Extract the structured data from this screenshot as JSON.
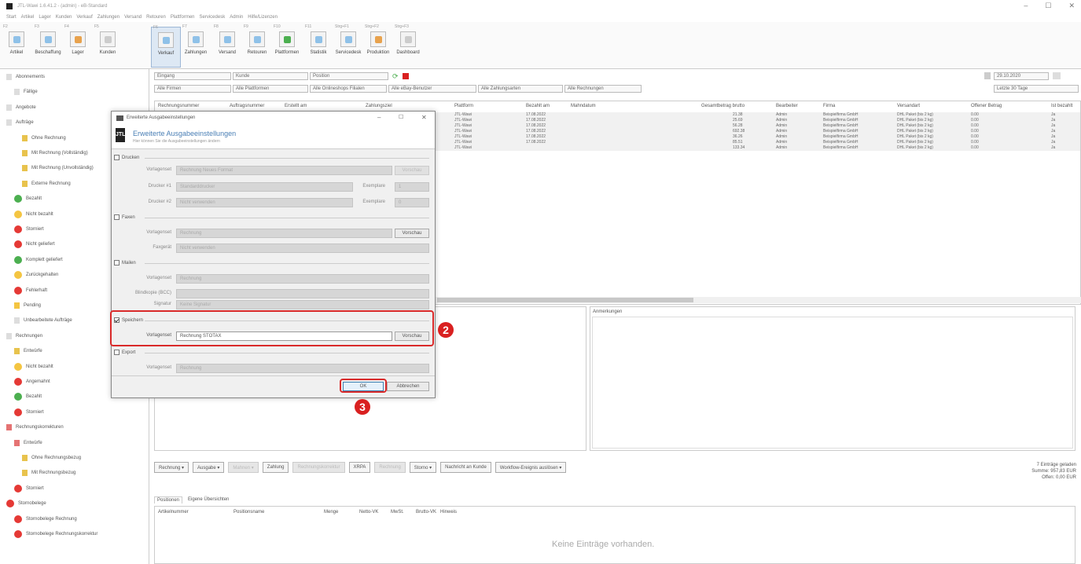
{
  "window": {
    "title": "JTL-Wawi 1.6.41.2 - (admin) - eB-Standard",
    "minimize": "–",
    "maximize": "☐",
    "close": "✕"
  },
  "menu": [
    "Start",
    "Artikel",
    "Lager",
    "Kunden",
    "Verkauf",
    "Zahlungen",
    "Versand",
    "Retouren",
    "Plattformen",
    "Servicedesk",
    "Admin",
    "Hilfe/Lizenzen"
  ],
  "ribbon": [
    {
      "key": "F2",
      "label": "Artikel",
      "color": "#8fc1e8"
    },
    {
      "key": "F3",
      "label": "Beschaffung",
      "color": "#8fc1e8"
    },
    {
      "key": "F4",
      "label": "Lager",
      "color": "#e8a24d"
    },
    {
      "key": "F5",
      "label": "Kunden",
      "color": "#cccccc"
    },
    {
      "key": "F6",
      "label": "Verkauf",
      "color": "#8fc1e8"
    },
    {
      "key": "F7",
      "label": "Zahlungen",
      "color": "#8fc1e8"
    },
    {
      "key": "F8",
      "label": "Versand",
      "color": "#8fc1e8"
    },
    {
      "key": "F9",
      "label": "Retouren",
      "color": "#8fc1e8"
    },
    {
      "key": "F10",
      "label": "Plattformen",
      "color": "#4caf50"
    },
    {
      "key": "F11",
      "label": "Statistik",
      "color": "#8fc1e8"
    },
    {
      "key": "Strg+F1",
      "label": "Servicedesk",
      "color": "#8fc1e8"
    },
    {
      "key": "Strg+F2",
      "label": "Produktion",
      "color": "#e8a24d"
    },
    {
      "key": "Strg+F3",
      "label": "Dashboard",
      "color": "#cccccc"
    }
  ],
  "sidebar": [
    {
      "label": "Abonnements",
      "type": "sq",
      "color": "#dddddd",
      "indent": 0
    },
    {
      "label": "Fällige",
      "type": "sq",
      "color": "#dddddd",
      "indent": 10
    },
    {
      "label": "Angebote",
      "type": "sq",
      "color": "#dddddd",
      "indent": 0
    },
    {
      "label": "Aufträge",
      "type": "sq",
      "color": "#dddddd",
      "indent": 0
    },
    {
      "label": "Ohne Rechnung",
      "type": "sq",
      "color": "#e8c34d",
      "indent": 20
    },
    {
      "label": "Mit Rechnung (Vollständig)",
      "type": "sq",
      "color": "#e8c34d",
      "indent": 20
    },
    {
      "label": "Mit Rechnung (Unvollständig)",
      "type": "sq",
      "color": "#e8c34d",
      "indent": 20
    },
    {
      "label": "Externe Rechnung",
      "type": "sq",
      "color": "#e8c34d",
      "indent": 20
    },
    {
      "label": "Bezahlt",
      "type": "dot",
      "color": "#4caf50",
      "indent": 10
    },
    {
      "label": "Nicht bezahlt",
      "type": "dot",
      "color": "#f4c542",
      "indent": 10
    },
    {
      "label": "Storniert",
      "type": "dot",
      "color": "#e53935",
      "indent": 10
    },
    {
      "label": "Nicht geliefert",
      "type": "dot",
      "color": "#e53935",
      "indent": 10
    },
    {
      "label": "Komplett geliefert",
      "type": "dot",
      "color": "#4caf50",
      "indent": 10
    },
    {
      "label": "Zurückgehalten",
      "type": "dot",
      "color": "#f4c542",
      "indent": 10
    },
    {
      "label": "Fehlerhaft",
      "type": "dot",
      "color": "#e53935",
      "indent": 10
    },
    {
      "label": "Pending",
      "type": "sq",
      "color": "#f4c542",
      "indent": 10
    },
    {
      "label": "Unbearbeitete Aufträge",
      "type": "sq",
      "color": "#dddddd",
      "indent": 10
    },
    {
      "label": "Rechnungen",
      "type": "sq",
      "color": "#dddddd",
      "indent": 0
    },
    {
      "label": "Entwürfe",
      "type": "sq",
      "color": "#e8c34d",
      "indent": 10
    },
    {
      "label": "Nicht bezahlt",
      "type": "dot",
      "color": "#f4c542",
      "indent": 10
    },
    {
      "label": "Angemahnt",
      "type": "dot",
      "color": "#e53935",
      "indent": 10
    },
    {
      "label": "Bezahlt",
      "type": "dot",
      "color": "#4caf50",
      "indent": 10
    },
    {
      "label": "Storniert",
      "type": "dot",
      "color": "#e53935",
      "indent": 10
    },
    {
      "label": "Rechnungskorrekturen",
      "type": "sq",
      "color": "#e57373",
      "indent": 0
    },
    {
      "label": "Entwürfe",
      "type": "sq",
      "color": "#e57373",
      "indent": 10
    },
    {
      "label": "Ohne Rechnungsbezug",
      "type": "sq",
      "color": "#e8c34d",
      "indent": 20
    },
    {
      "label": "Mit Rechnungsbezug",
      "type": "sq",
      "color": "#e8c34d",
      "indent": 20
    },
    {
      "label": "Storniert",
      "type": "dot",
      "color": "#e53935",
      "indent": 10
    },
    {
      "label": "Stornobelege",
      "type": "dot",
      "color": "#e53935",
      "indent": 0
    },
    {
      "label": "Stornobelege Rechnung",
      "type": "dot",
      "color": "#e53935",
      "indent": 10
    },
    {
      "label": "Stornobelege Rechnungskorrektur",
      "type": "dot",
      "color": "#e53935",
      "indent": 10
    }
  ],
  "filters": {
    "row1": [
      "Eingang",
      "Kunde",
      "Position"
    ],
    "row2": [
      "Alle Firmen",
      "Alle Plattformen",
      "Alle Onlineshops Filialen",
      "Alle eBay-Benutzer",
      "Alle Zahlungsarten",
      "Alle Rechnungen"
    ],
    "date": "29.10.2020",
    "range": "Letzte 30 Tage"
  },
  "grid": {
    "headers": [
      "Rechnungsnummer",
      "Auftragsnummer",
      "Erstellt am",
      "Zahlungsziel",
      "Plattform",
      "Bezahlt am",
      "Mahndatum",
      "Gesamtbetrag brutto",
      "Bearbeiter",
      "Firma",
      "Versandart",
      "Offener Betrag",
      "Ist bezahlt"
    ],
    "rows": [
      [
        "JTL-Wawi",
        "17.08.2022",
        "21.38",
        "Admin",
        "Beispielfirma GmbH",
        "DHL Paket (bis 2 kg)",
        "0.00",
        "Ja"
      ],
      [
        "JTL-Wawi",
        "17.08.2022",
        "25.69",
        "Admin",
        "Beispielfirma GmbH",
        "DHL Paket (bis 2 kg)",
        "0.00",
        "Ja"
      ],
      [
        "JTL-Wawi",
        "17.08.2022",
        "56.28",
        "Admin",
        "Beispielfirma GmbH",
        "DHL Paket (bis 2 kg)",
        "0.00",
        "Ja"
      ],
      [
        "JTL-Wawi",
        "17.08.2022",
        "692.38",
        "Admin",
        "Beispielfirma GmbH",
        "DHL Paket (bis 2 kg)",
        "0.00",
        "Ja"
      ],
      [
        "JTL-Wawi",
        "17.08.2022",
        "36.26",
        "Admin",
        "Beispielfirma GmbH",
        "DHL Paket (bis 2 kg)",
        "0.00",
        "Ja"
      ],
      [
        "JTL-Wawi",
        "17.08.2022",
        "85.51",
        "Admin",
        "Beispielfirma GmbH",
        "DHL Paket (bis 2 kg)",
        "0.00",
        "Ja"
      ],
      [
        "JTL-Wawi",
        "",
        "133.34",
        "Admin",
        "Beispielfirma GmbH",
        "DHL Paket (bis 2 kg)",
        "0.00",
        "Ja"
      ]
    ]
  },
  "notes_label": "Anmerkungen",
  "actions": [
    {
      "label": "Rechnung ▾",
      "dis": false
    },
    {
      "label": "Ausgabe ▾",
      "dis": false
    },
    {
      "label": "Mahnen ▾",
      "dis": true
    },
    {
      "label": "Zahlung",
      "dis": false
    },
    {
      "label": "Rechnungskorrektur",
      "dis": true
    },
    {
      "label": "XRPA",
      "dis": false
    },
    {
      "label": "Rechnung",
      "dis": true
    },
    {
      "label": "Storno ▾",
      "dis": false
    },
    {
      "label": "Nachricht an Kunde",
      "dis": false
    },
    {
      "label": "Workflow-Ereignis auslösen ▾",
      "dis": false
    }
  ],
  "summary": {
    "count": "7 Einträge geladen",
    "sum": "Summe: 957,83 EUR",
    "open": "Offen: 0,00 EUR"
  },
  "bottom_tabs": [
    "Positionen",
    "Eigene Übersichten"
  ],
  "bottom_headers": [
    "Artikelnummer",
    "Positionsname",
    "Menge",
    "Netto-VK",
    "MwSt.",
    "Brutto-VK",
    "Hinweis"
  ],
  "empty_text": "Keine Einträge vorhanden.",
  "dialog": {
    "title": "Erweiterte Ausgabeeinstellungen",
    "header_title": "Erweiterte Ausgabeeinstellungen",
    "header_sub": "Hier können Sie die Ausgabeeinstellungen ändern",
    "logo": "JTL",
    "sections": {
      "print": {
        "label": "Drucken",
        "vorlage_label": "Vorlagenset",
        "vorlage": "Rechnung Neues Format",
        "vorschau": "Vorschau",
        "drucker1_label": "Drucker #1",
        "drucker1": "Standarddrucker",
        "drucker2_label": "Drucker #2",
        "drucker2": "Nicht verwenden",
        "exemplare_label": "Exemplare",
        "exemplare1": "1",
        "exemplare2": "0"
      },
      "fax": {
        "label": "Faxen",
        "vorlage_label": "Vorlagenset",
        "vorlage": "Rechnung",
        "vorschau": "Vorschau",
        "faxgeraet_label": "Faxgerät",
        "faxgeraet": "Nicht verwenden"
      },
      "mail": {
        "label": "Mailen",
        "vorlage_label": "Vorlagenset",
        "vorlage": "Rechnung",
        "bcc_label": "Blindkopie (BCC)",
        "bcc": "",
        "signatur_label": "Signatur",
        "signatur": "Keine Signatur"
      },
      "save": {
        "label": "Speichern",
        "vorlage_label": "Vorlagenset",
        "vorlage": "Rechnung STOTAX",
        "vorschau": "Vorschau"
      },
      "export": {
        "label": "Export",
        "vorlage_label": "Vorlagenset",
        "vorlage": "Rechnung"
      }
    },
    "ok": "OK",
    "cancel": "Abbrechen"
  },
  "annotations": {
    "step2": "2",
    "step3": "3",
    "color": "#d92a2a"
  }
}
